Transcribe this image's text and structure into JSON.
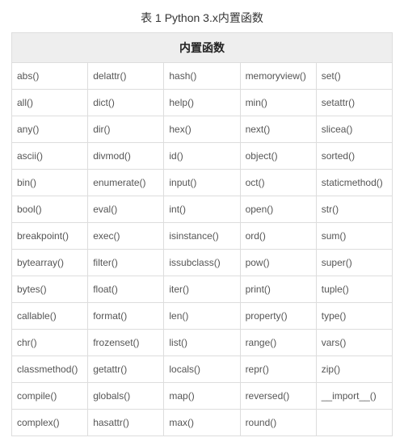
{
  "caption": "表 1 Python 3.x内置函数",
  "header": "内置函数",
  "rows": [
    [
      "abs()",
      "delattr()",
      "hash()",
      "memoryview()",
      "set()"
    ],
    [
      "all()",
      "dict()",
      "help()",
      "min()",
      "setattr()"
    ],
    [
      "any()",
      "dir()",
      "hex()",
      "next()",
      "slicea()"
    ],
    [
      "ascii()",
      "divmod()",
      "id()",
      "object()",
      "sorted()"
    ],
    [
      "bin()",
      "enumerate()",
      "input()",
      "oct()",
      "staticmethod()"
    ],
    [
      "bool()",
      "eval()",
      "int()",
      "open()",
      "str()"
    ],
    [
      "breakpoint()",
      "exec()",
      "isinstance()",
      "ord()",
      "sum()"
    ],
    [
      "bytearray()",
      "filter()",
      "issubclass()",
      "pow()",
      "super()"
    ],
    [
      "bytes()",
      "float()",
      "iter()",
      "print()",
      "tuple()"
    ],
    [
      "callable()",
      "format()",
      "len()",
      "property()",
      "type()"
    ],
    [
      "chr()",
      "frozenset()",
      "list()",
      "range()",
      "vars()"
    ],
    [
      "classmethod()",
      "getattr()",
      "locals()",
      "repr()",
      "zip()"
    ],
    [
      "compile()",
      "globals()",
      "map()",
      "reversed()",
      "__import__()"
    ],
    [
      "complex()",
      "hasattr()",
      "max()",
      "round()",
      ""
    ]
  ]
}
